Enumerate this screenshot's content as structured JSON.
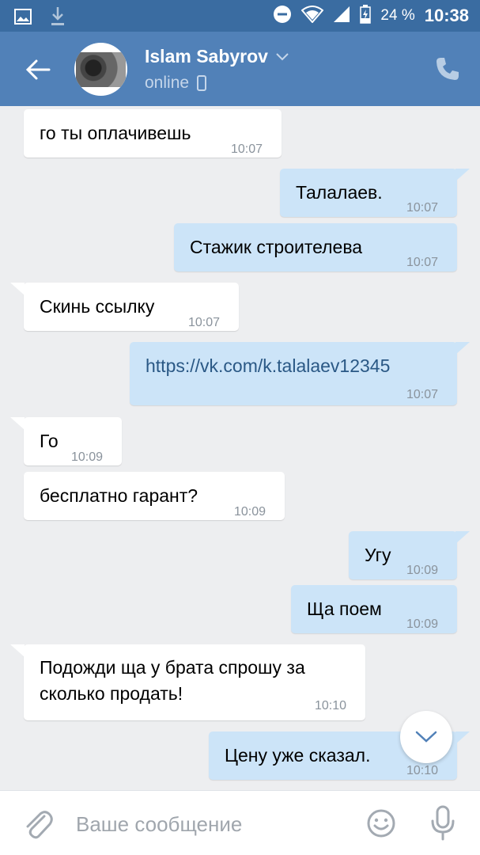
{
  "status_bar": {
    "battery_percent": "24 %",
    "time": "10:38",
    "icons": [
      "image-icon",
      "download-icon",
      "do-not-disturb-icon",
      "wifi-icon",
      "signal-icon",
      "battery-icon"
    ]
  },
  "header": {
    "name": "Islam Sabyrov",
    "status": "online",
    "icons": [
      "back-arrow-icon",
      "chevron-down-icon",
      "mobile-device-icon",
      "phone-icon"
    ]
  },
  "messages": [
    {
      "dir": "in",
      "text": "го ты оплачивешь",
      "time": "10:07"
    },
    {
      "dir": "out",
      "text": "Талалаев.",
      "time": "10:07"
    },
    {
      "dir": "out",
      "text": "Стажик строителева",
      "time": "10:07"
    },
    {
      "dir": "in",
      "text": "Скинь ссылку",
      "time": "10:07"
    },
    {
      "dir": "out",
      "text": "https://vk.com/k.talalaev12345",
      "time": "10:07"
    },
    {
      "dir": "in",
      "text": "Го",
      "time": "10:09"
    },
    {
      "dir": "in",
      "text": "бесплатно гарант?",
      "time": "10:09"
    },
    {
      "dir": "out",
      "text": "Угу",
      "time": "10:09"
    },
    {
      "dir": "out",
      "text": "Ща поем",
      "time": "10:09"
    },
    {
      "dir": "in",
      "text_line1": "Подожди ща у брата спрошу за",
      "text_line2": "сколько продать!",
      "time": "10:10"
    },
    {
      "dir": "out",
      "text": "Цену уже сказал.",
      "time": "10:10"
    }
  ],
  "composer": {
    "placeholder": "Ваше сообщение",
    "icons": [
      "paperclip-icon",
      "emoji-icon",
      "microphone-icon"
    ]
  },
  "colors": {
    "status_bar": "#3a6ca1",
    "header": "#5181b8",
    "background": "#edeef0",
    "incoming_bubble": "#ffffff",
    "outgoing_bubble": "#cce4f8",
    "link": "#2a5885"
  }
}
